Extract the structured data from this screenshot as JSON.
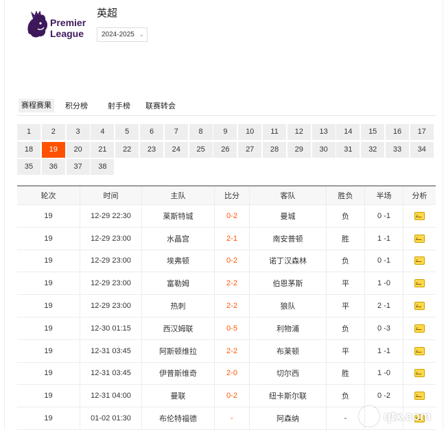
{
  "header": {
    "logo_text": [
      "Premier",
      "League"
    ],
    "league_name": "英超",
    "season": "2024-2025"
  },
  "tabs": [
    {
      "label": "赛程赛果",
      "active": true
    },
    {
      "label": "积分榜",
      "active": false
    },
    {
      "label": "射手榜",
      "active": false
    },
    {
      "label": "联赛转会",
      "active": false
    }
  ],
  "rounds": {
    "items": [
      "1",
      "2",
      "3",
      "4",
      "5",
      "6",
      "7",
      "8",
      "9",
      "10",
      "11",
      "12",
      "13",
      "14",
      "15",
      "16",
      "17",
      "18",
      "19",
      "20",
      "21",
      "22",
      "23",
      "24",
      "25",
      "26",
      "27",
      "28",
      "29",
      "30",
      "31",
      "32",
      "33",
      "34",
      "35",
      "36",
      "37",
      "38"
    ],
    "selected": "19"
  },
  "table": {
    "headers": [
      "轮次",
      "时间",
      "主队",
      "比分",
      "客队",
      "胜负",
      "半场",
      "分析"
    ],
    "rows": [
      {
        "round": "19",
        "time": "12-29 22:30",
        "home": "莱斯特城",
        "score": "0-2",
        "away": "曼城",
        "result": "负",
        "half": "0 -1"
      },
      {
        "round": "19",
        "time": "12-29 23:00",
        "home": "水晶宫",
        "score": "2-1",
        "away": "南安普顿",
        "result": "胜",
        "half": "1 -1"
      },
      {
        "round": "19",
        "time": "12-29 23:00",
        "home": "埃弗顿",
        "score": "0-2",
        "away": "诺丁汉森林",
        "result": "负",
        "half": "0 -1"
      },
      {
        "round": "19",
        "time": "12-29 23:00",
        "home": "富勒姆",
        "score": "2-2",
        "away": "伯恩茅斯",
        "result": "平",
        "half": "1 -0"
      },
      {
        "round": "19",
        "time": "12-29 23:00",
        "home": "热刺",
        "score": "2-2",
        "away": "狼队",
        "result": "平",
        "half": "2 -1"
      },
      {
        "round": "19",
        "time": "12-30 01:15",
        "home": "西汉姆联",
        "score": "0-5",
        "away": "利物浦",
        "result": "负",
        "half": "0 -3"
      },
      {
        "round": "19",
        "time": "12-31 03:45",
        "home": "阿斯顿维拉",
        "score": "2-2",
        "away": "布莱顿",
        "result": "平",
        "half": "1 -1"
      },
      {
        "round": "19",
        "time": "12-31 03:45",
        "home": "伊普斯维奇",
        "score": "2-0",
        "away": "切尔西",
        "result": "胜",
        "half": "1 -0"
      },
      {
        "round": "19",
        "time": "12-31 04:00",
        "home": "曼联",
        "score": "0-2",
        "away": "纽卡斯尔联",
        "result": "负",
        "half": "0 -2"
      },
      {
        "round": "19",
        "time": "01-02 01:30",
        "home": "布伦特福德",
        "score": "-",
        "away": "阿森纳",
        "result": "-",
        "half": ""
      }
    ]
  },
  "watermark": "qtx.com",
  "colors": {
    "accent": "#ff5200",
    "logo_purple": "#3d195b"
  }
}
